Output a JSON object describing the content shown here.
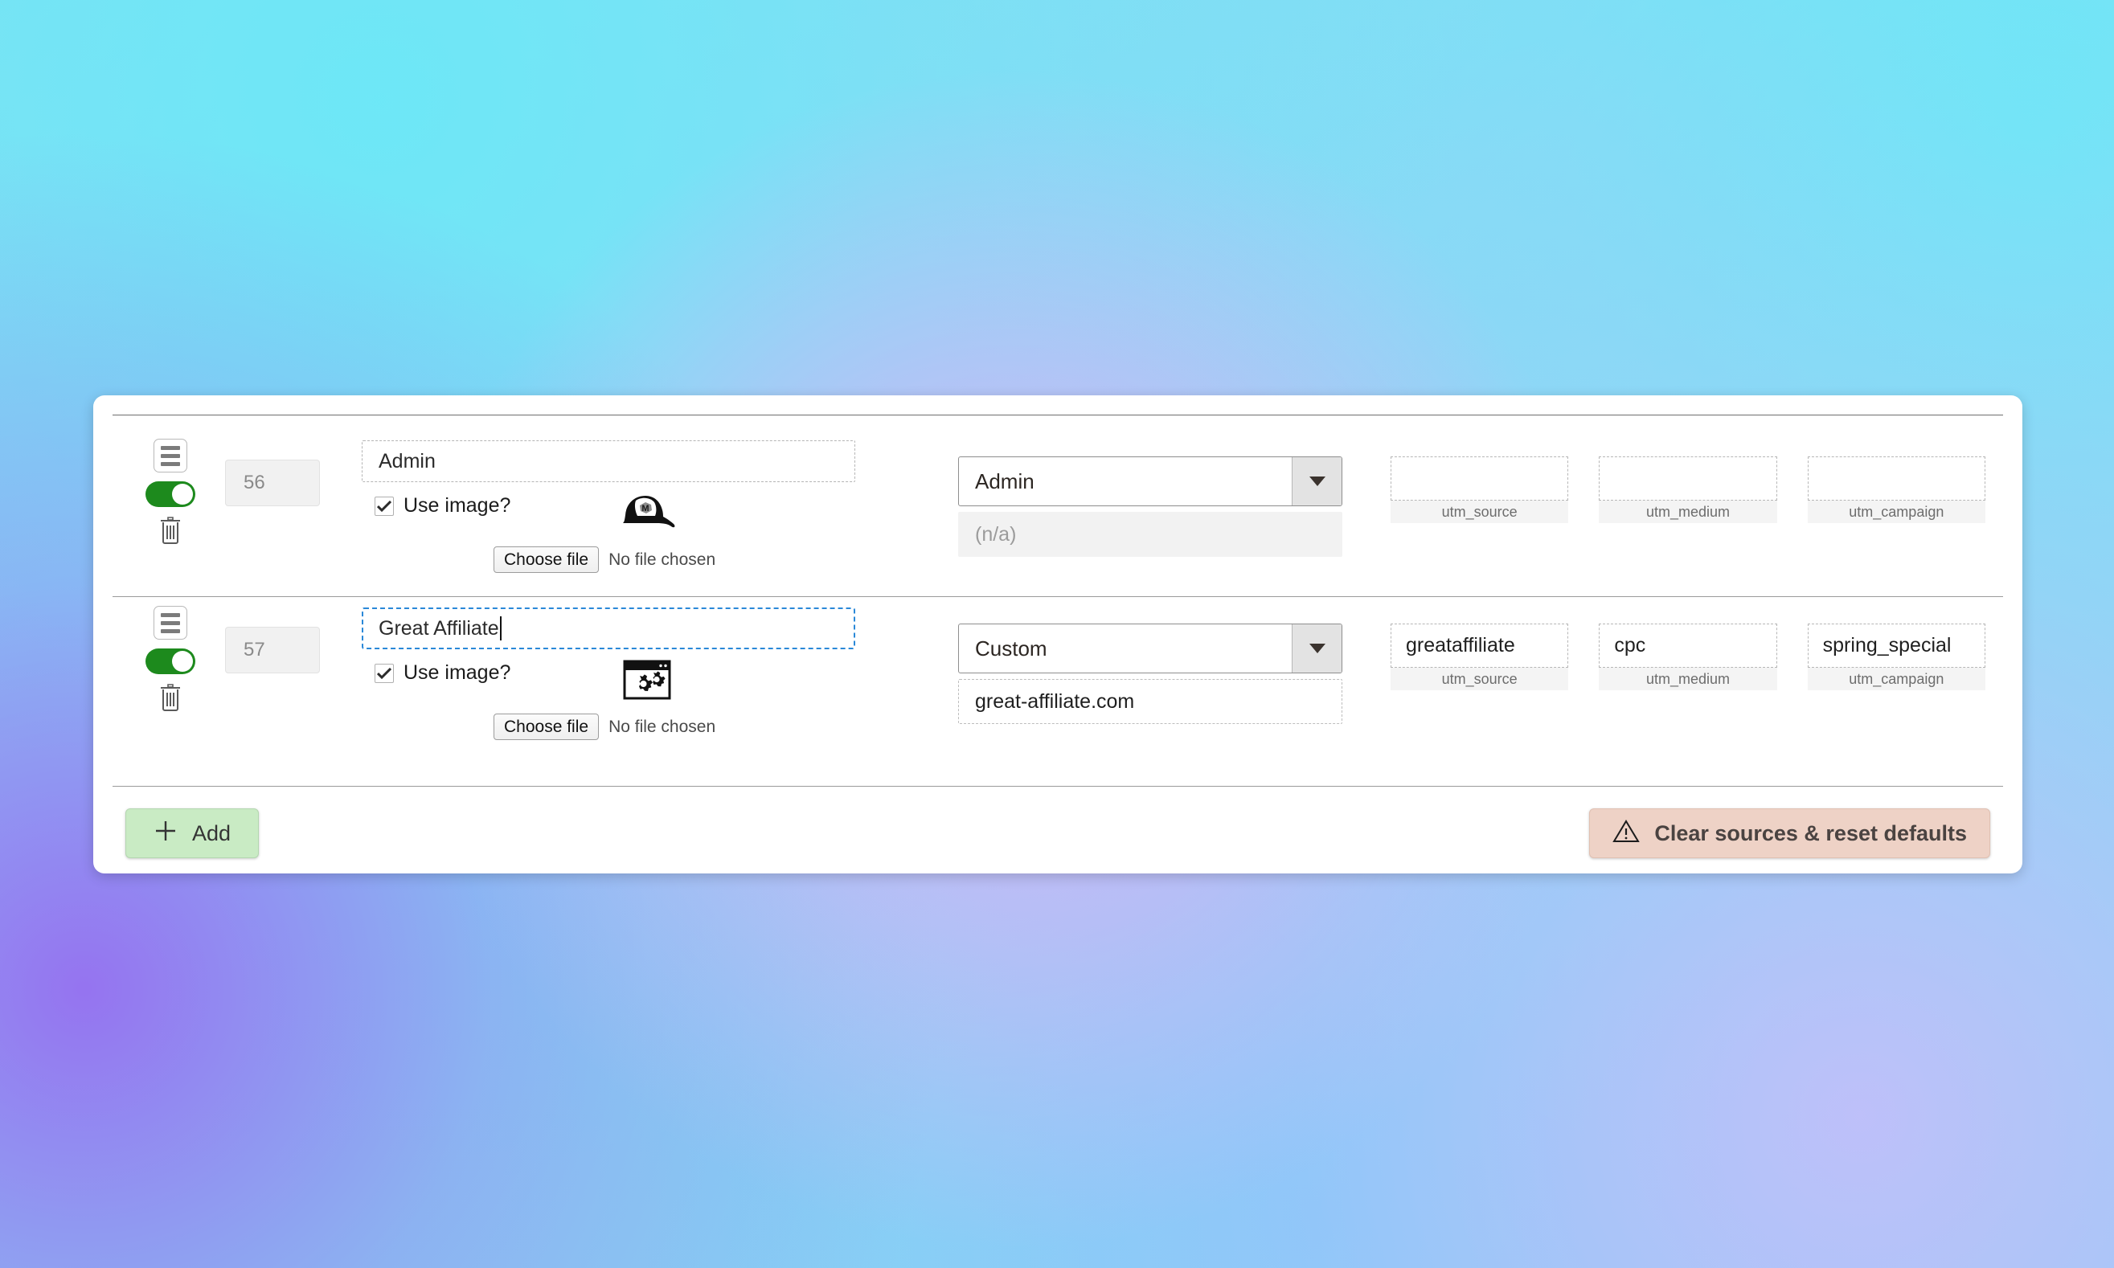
{
  "card": {
    "rows": [
      {
        "id": "56",
        "enabled": true,
        "name": "Admin",
        "name_focused": false,
        "use_image_label": "Use image?",
        "use_image_checked": true,
        "image_icon": "baseball-cap-icon",
        "choose_file_label": "Choose file",
        "no_file_label": "No file chosen",
        "preset": "Admin",
        "domain": "(n/a)",
        "domain_disabled": true,
        "utm": [
          {
            "value": "",
            "caption": "utm_source"
          },
          {
            "value": "",
            "caption": "utm_medium"
          },
          {
            "value": "",
            "caption": "utm_campaign"
          }
        ]
      },
      {
        "id": "57",
        "enabled": true,
        "name": "Great Affiliate",
        "name_focused": true,
        "use_image_label": "Use image?",
        "use_image_checked": true,
        "image_icon": "browser-gears-icon",
        "choose_file_label": "Choose file",
        "no_file_label": "No file chosen",
        "preset": "Custom",
        "domain": "great-affiliate.com",
        "domain_disabled": false,
        "utm": [
          {
            "value": "greataffiliate",
            "caption": "utm_source"
          },
          {
            "value": "cpc",
            "caption": "utm_medium"
          },
          {
            "value": "spring_special",
            "caption": "utm_campaign"
          }
        ]
      }
    ]
  },
  "footer": {
    "add_label": "Add",
    "add_icon": "plus-icon",
    "clear_label": "Clear sources & reset defaults",
    "clear_icon": "warning-triangle-icon"
  },
  "colors": {
    "toggle_on": "#1d8a1d",
    "add_bg": "#c9ebc4",
    "clear_bg": "#eed2c6",
    "focus_border": "#2a88d8"
  }
}
